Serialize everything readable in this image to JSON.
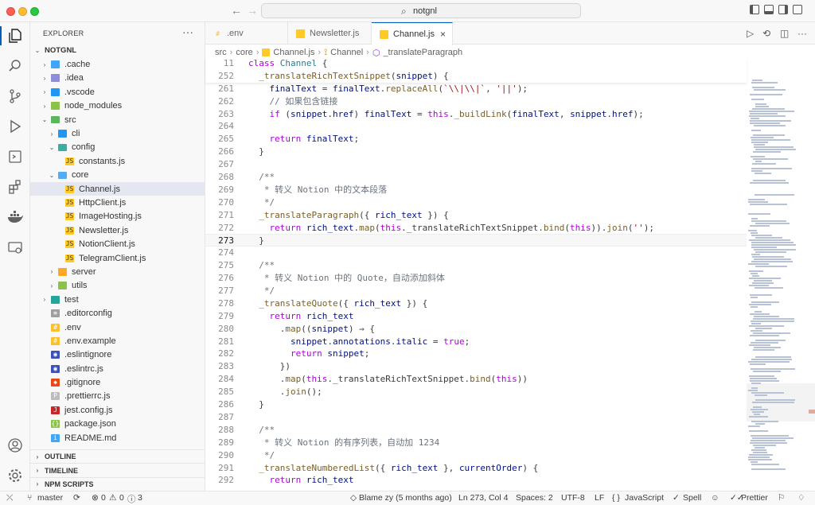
{
  "window": {
    "search_text": "notgnl",
    "nav_back": "←",
    "nav_forward": "→"
  },
  "sidebar": {
    "title": "EXPLORER",
    "more": "···",
    "root": "NOTGNL",
    "items": [
      {
        "label": ".cache",
        "indent": 1,
        "chev": "›",
        "icon": "folder",
        "color": "#42a5f5"
      },
      {
        "label": ".idea",
        "indent": 1,
        "chev": "›",
        "icon": "folder",
        "color": "#8e8ed8"
      },
      {
        "label": ".vscode",
        "indent": 1,
        "chev": "›",
        "icon": "folder",
        "color": "#2196f3"
      },
      {
        "label": "node_modules",
        "indent": 1,
        "chev": "›",
        "icon": "folder",
        "color": "#8bc34a"
      },
      {
        "label": "src",
        "indent": 1,
        "chev": "⌄",
        "icon": "folder-open",
        "color": "#4caf50"
      },
      {
        "label": "cli",
        "indent": 2,
        "chev": "›",
        "icon": "folder",
        "color": "#2196f3"
      },
      {
        "label": "config",
        "indent": 2,
        "chev": "⌄",
        "icon": "folder-open",
        "color": "#26a69a"
      },
      {
        "label": "constants.js",
        "indent": 3,
        "chev": "",
        "icon": "js",
        "color": "#ffca28"
      },
      {
        "label": "core",
        "indent": 2,
        "chev": "⌄",
        "icon": "folder-open",
        "color": "#42a5f5"
      },
      {
        "label": "Channel.js",
        "indent": 3,
        "chev": "",
        "icon": "js",
        "color": "#ffca28",
        "selected": true
      },
      {
        "label": "HttpClient.js",
        "indent": 3,
        "chev": "",
        "icon": "js",
        "color": "#ffca28"
      },
      {
        "label": "ImageHosting.js",
        "indent": 3,
        "chev": "",
        "icon": "js",
        "color": "#ffca28"
      },
      {
        "label": "Newsletter.js",
        "indent": 3,
        "chev": "",
        "icon": "js",
        "color": "#ffca28"
      },
      {
        "label": "NotionClient.js",
        "indent": 3,
        "chev": "",
        "icon": "js",
        "color": "#ffca28"
      },
      {
        "label": "TelegramClient.js",
        "indent": 3,
        "chev": "",
        "icon": "js",
        "color": "#ffca28"
      },
      {
        "label": "server",
        "indent": 2,
        "chev": "›",
        "icon": "folder",
        "color": "#ffa726"
      },
      {
        "label": "utils",
        "indent": 2,
        "chev": "›",
        "icon": "folder",
        "color": "#8bc34a"
      },
      {
        "label": "test",
        "indent": 1,
        "chev": "›",
        "icon": "folder",
        "color": "#26a69a"
      },
      {
        "label": ".editorconfig",
        "indent": 1,
        "chev": "",
        "icon": "cfg",
        "color": "#9e9e9e"
      },
      {
        "label": ".env",
        "indent": 1,
        "chev": "",
        "icon": "env",
        "color": "#fbc02d"
      },
      {
        "label": ".env.example",
        "indent": 1,
        "chev": "",
        "icon": "env",
        "color": "#fbc02d"
      },
      {
        "label": ".eslintignore",
        "indent": 1,
        "chev": "",
        "icon": "eslint",
        "color": "#3f51b5"
      },
      {
        "label": ".eslintrc.js",
        "indent": 1,
        "chev": "",
        "icon": "eslint",
        "color": "#3f51b5"
      },
      {
        "label": ".gitignore",
        "indent": 1,
        "chev": "",
        "icon": "git",
        "color": "#e64a19"
      },
      {
        "label": ".prettierrc.js",
        "indent": 1,
        "chev": "",
        "icon": "prettier",
        "color": "#bdbdbd"
      },
      {
        "label": "jest.config.js",
        "indent": 1,
        "chev": "",
        "icon": "jest",
        "color": "#c62828"
      },
      {
        "label": "package.json",
        "indent": 1,
        "chev": "",
        "icon": "json",
        "color": "#8bc34a"
      },
      {
        "label": "README.md",
        "indent": 1,
        "chev": "",
        "icon": "info",
        "color": "#42a5f5"
      }
    ],
    "sections": [
      "OUTLINE",
      "TIMELINE",
      "NPM SCRIPTS"
    ]
  },
  "editor": {
    "tabs": [
      {
        "label": ".env",
        "icon": "env",
        "color": "#fbc02d"
      },
      {
        "label": "Newsletter.js",
        "icon": "js",
        "color": "#ffca28"
      },
      {
        "label": "Channel.js",
        "icon": "js",
        "color": "#ffca28",
        "active": true
      }
    ],
    "tab_close": "×",
    "breadcrumb": [
      "src",
      "core",
      "Channel.js",
      "Channel",
      "_translateParagraph"
    ],
    "lines": [
      {
        "n": "11",
        "t": "class Channel {",
        "sticky": true
      },
      {
        "n": "252",
        "t": "  _translateRichTextSnippet(snippet) {",
        "sticky": true
      },
      {
        "n": "261",
        "t": "    finalText = finalText.replaceAll(`\\\\|\\\\|`, '||');"
      },
      {
        "n": "262",
        "t": "    // 如果包含链接"
      },
      {
        "n": "263",
        "t": "    if (snippet.href) finalText = this._buildLink(finalText, snippet.href);"
      },
      {
        "n": "264",
        "t": ""
      },
      {
        "n": "265",
        "t": "    return finalText;"
      },
      {
        "n": "266",
        "t": "  }"
      },
      {
        "n": "267",
        "t": ""
      },
      {
        "n": "268",
        "t": "  /**"
      },
      {
        "n": "269",
        "t": "   * 转义 Notion 中的文本段落"
      },
      {
        "n": "270",
        "t": "   */"
      },
      {
        "n": "271",
        "t": "  _translateParagraph({ rich_text }) {"
      },
      {
        "n": "272",
        "t": "    return rich_text.map(this._translateRichTextSnippet.bind(this)).join('');"
      },
      {
        "n": "273",
        "t": "  }",
        "current": true
      },
      {
        "n": "274",
        "t": ""
      },
      {
        "n": "275",
        "t": "  /**"
      },
      {
        "n": "276",
        "t": "   * 转义 Notion 中的 Quote，自动添加斜体"
      },
      {
        "n": "277",
        "t": "   */"
      },
      {
        "n": "278",
        "t": "  _translateQuote({ rich_text }) {"
      },
      {
        "n": "279",
        "t": "    return rich_text"
      },
      {
        "n": "280",
        "t": "      .map((snippet) ⇒ {"
      },
      {
        "n": "281",
        "t": "        snippet.annotations.italic = true;"
      },
      {
        "n": "282",
        "t": "        return snippet;"
      },
      {
        "n": "283",
        "t": "      })"
      },
      {
        "n": "284",
        "t": "      .map(this._translateRichTextSnippet.bind(this))"
      },
      {
        "n": "285",
        "t": "      .join();"
      },
      {
        "n": "286",
        "t": "  }"
      },
      {
        "n": "287",
        "t": ""
      },
      {
        "n": "288",
        "t": "  /**"
      },
      {
        "n": "289",
        "t": "   * 转义 Notion 的有序列表，自动加 1234"
      },
      {
        "n": "290",
        "t": "   */"
      },
      {
        "n": "291",
        "t": "  _translateNumberedList({ rich_text }, currentOrder) {"
      },
      {
        "n": "292",
        "t": "    return rich_text"
      }
    ]
  },
  "status": {
    "branch": "master",
    "errors": "0",
    "warnings": "0",
    "info": "3",
    "blame": "Blame zy (5 months ago)",
    "position": "Ln 273, Col 4",
    "spaces": "Spaces: 2",
    "encoding": "UTF-8",
    "eol": "LF",
    "language": "JavaScript",
    "spell": "Spell",
    "prettier": "Prettier"
  }
}
